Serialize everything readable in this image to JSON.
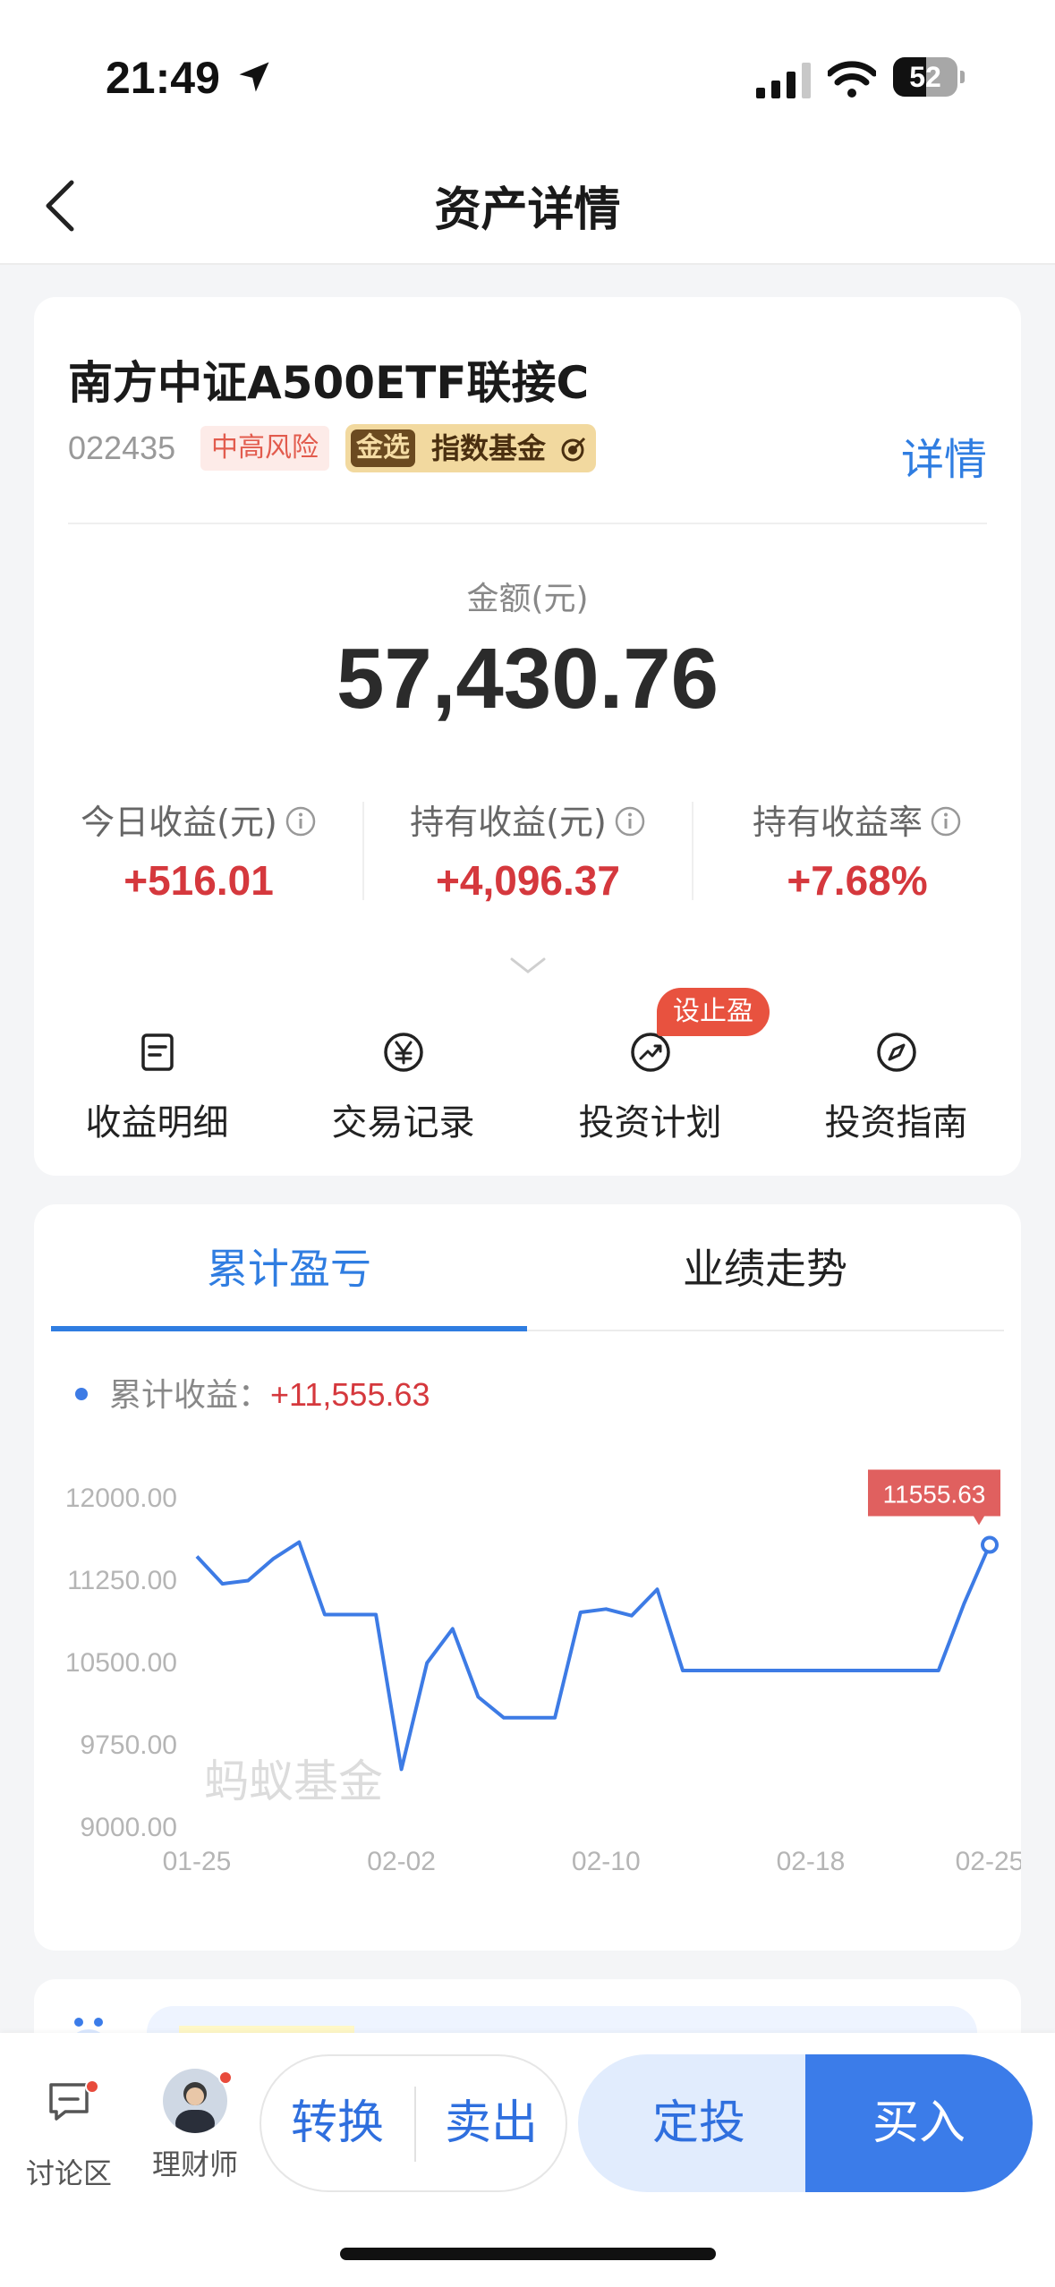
{
  "status": {
    "time": "21:49",
    "battery_percent": 52,
    "battery_label": "52"
  },
  "nav": {
    "title": "资产详情"
  },
  "fund": {
    "name": "南方中证A500ETF联接C",
    "code": "022435",
    "risk_tag": "中高风险",
    "gold_badge": "金选",
    "gold_text": "指数基金",
    "detail_link": "详情"
  },
  "amount": {
    "label": "金额(元)",
    "value": "57,430.76"
  },
  "stats": [
    {
      "label": "今日收益(元)",
      "value": "+516.01"
    },
    {
      "label": "持有收益(元)",
      "value": "+4,096.37"
    },
    {
      "label": "持有收益率",
      "value": "+7.68%"
    }
  ],
  "actions": [
    {
      "label": "收益明细",
      "icon": "document-icon"
    },
    {
      "label": "交易记录",
      "icon": "yen-circle-icon"
    },
    {
      "label": "投资计划",
      "icon": "trend-circle-icon",
      "badge": "设止盈"
    },
    {
      "label": "投资指南",
      "icon": "compass-icon"
    }
  ],
  "chart_tabs": [
    "累计盈亏",
    "业绩走势"
  ],
  "legend": {
    "label": "累计收益：",
    "value": "+11,555.63"
  },
  "watermark": "蚂蚁基金",
  "chart_data": {
    "type": "line",
    "series": [
      {
        "values": [
          {
            "x": "01-25",
            "y": 11450
          },
          {
            "x": "01-26",
            "y": 11200
          },
          {
            "x": "01-27",
            "y": 11230
          },
          {
            "x": "01-28",
            "y": 11430
          },
          {
            "x": "01-29",
            "y": 11580
          },
          {
            "x": "01-30",
            "y": 10920
          },
          {
            "x": "01-31",
            "y": 10920
          },
          {
            "x": "02-01",
            "y": 10920
          },
          {
            "x": "02-02",
            "y": 9510
          },
          {
            "x": "02-03",
            "y": 10480
          },
          {
            "x": "02-04",
            "y": 10790
          },
          {
            "x": "02-05",
            "y": 10170
          },
          {
            "x": "02-06",
            "y": 9980
          },
          {
            "x": "02-07",
            "y": 9980
          },
          {
            "x": "02-08",
            "y": 9980
          },
          {
            "x": "02-09",
            "y": 10940
          },
          {
            "x": "02-10",
            "y": 10970
          },
          {
            "x": "02-11",
            "y": 10910
          },
          {
            "x": "02-12",
            "y": 11150
          },
          {
            "x": "02-13",
            "y": 10410
          },
          {
            "x": "02-14",
            "y": 10410
          },
          {
            "x": "02-15",
            "y": 10410
          },
          {
            "x": "02-16",
            "y": 10410
          },
          {
            "x": "02-17",
            "y": 10410
          },
          {
            "x": "02-18",
            "y": 10410
          },
          {
            "x": "02-19",
            "y": 10410
          },
          {
            "x": "02-20",
            "y": 10410
          },
          {
            "x": "02-21",
            "y": 10410
          },
          {
            "x": "02-22",
            "y": 10410
          },
          {
            "x": "02-23",
            "y": 10410
          },
          {
            "x": "02-24",
            "y": 11020
          },
          {
            "x": "02-25",
            "y": 11555.63
          }
        ]
      }
    ],
    "y_ticks": [
      "12000.00",
      "11250.00",
      "10500.00",
      "9750.00",
      "9000.00"
    ],
    "ylim": [
      9000,
      12000
    ],
    "x_ticks": [
      "01-25",
      "02-02",
      "02-10",
      "02-18",
      "02-25"
    ],
    "last_label": "11555.63",
    "line_color": "#3d7be5",
    "grid": false
  },
  "bottom": {
    "discuss": "讨论区",
    "advisor": "理财师",
    "convert": "转换",
    "sell": "卖出",
    "auto_invest": "定投",
    "buy": "买入"
  },
  "colors": {
    "accent": "#2f7de1",
    "gain": "#d5383d",
    "buy": "#3b7ce9"
  }
}
